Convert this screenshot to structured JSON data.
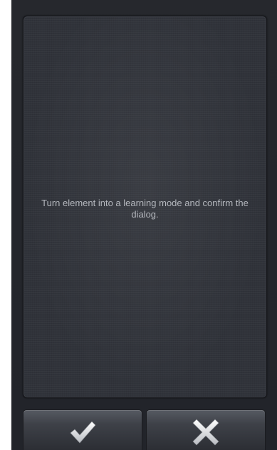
{
  "dialog": {
    "message": "Turn element into a learning mode and confirm the dialog."
  },
  "buttons": {
    "confirm_icon": "checkmark-icon",
    "cancel_icon": "close-icon"
  }
}
